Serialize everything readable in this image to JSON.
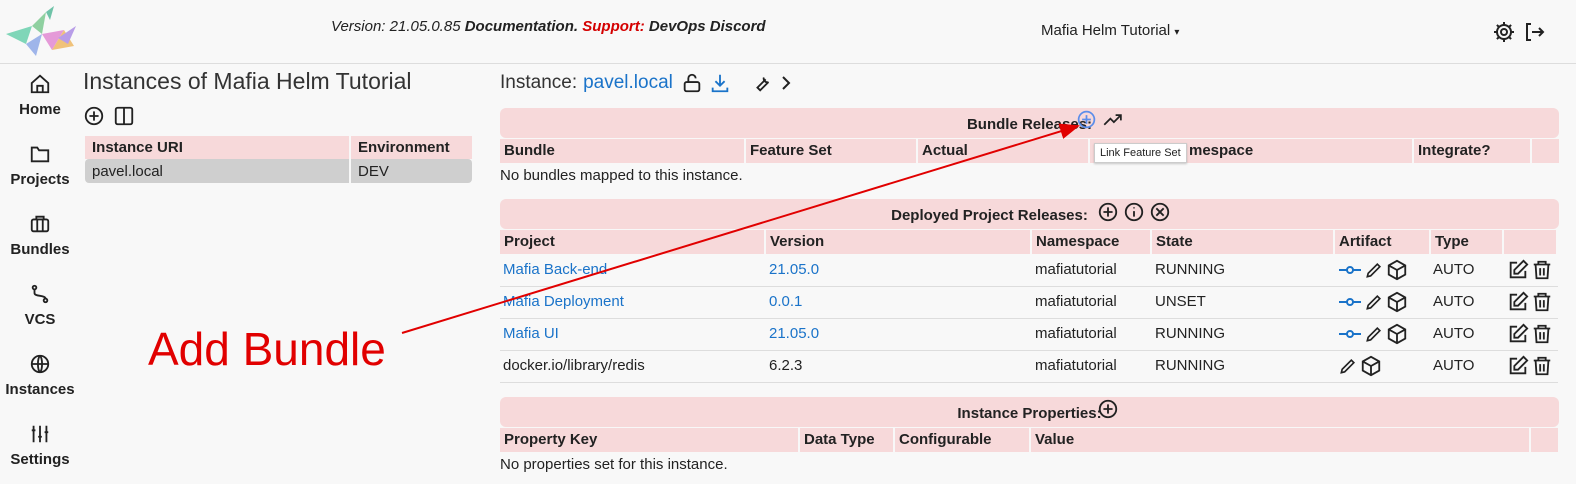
{
  "header": {
    "version_label": "Version: 21.05.0.85",
    "documentation_label": "Documentation.",
    "support_label": "Support:",
    "discord_label": "DevOps Discord",
    "project_select": "Mafia Helm Tutorial",
    "colors": {
      "support": "#d40000",
      "link": "#1a73c9",
      "section_bg": "#f7d9da"
    }
  },
  "sidebar": {
    "items": [
      {
        "label": "Home",
        "icon": "home-icon"
      },
      {
        "label": "Projects",
        "icon": "folder-icon"
      },
      {
        "label": "Bundles",
        "icon": "briefcase-icon"
      },
      {
        "label": "VCS",
        "icon": "git-branch-icon"
      },
      {
        "label": "Instances",
        "icon": "globe-icon"
      },
      {
        "label": "Settings",
        "icon": "sliders-icon"
      }
    ]
  },
  "left_panel": {
    "title": "Instances of Mafia Helm Tutorial",
    "columns": [
      "Instance URI",
      "Environment"
    ],
    "rows": [
      {
        "uri": "pavel.local",
        "environment": "DEV"
      }
    ]
  },
  "instance": {
    "label": "Instance:",
    "uri": "pavel.local"
  },
  "bundle_releases": {
    "title": "Bundle Releases:",
    "columns": [
      "Bundle",
      "Feature Set",
      "Actual",
      "Namespace",
      "Integrate?"
    ],
    "namespace_visible": "mespace",
    "empty_message": "No bundles mapped to this instance.",
    "tooltip": "Link Feature Set"
  },
  "deployed_releases": {
    "title": "Deployed Project Releases:",
    "columns": [
      "Project",
      "Version",
      "Namespace",
      "State",
      "Artifact",
      "Type"
    ],
    "rows": [
      {
        "project": "Mafia Back-end",
        "version": "21.05.0",
        "namespace": "mafiatutorial",
        "state": "RUNNING",
        "type": "AUTO",
        "linked": true
      },
      {
        "project": "Mafia Deployment",
        "version": "0.0.1",
        "namespace": "mafiatutorial",
        "state": "UNSET",
        "type": "AUTO",
        "linked": true
      },
      {
        "project": "Mafia UI",
        "version": "21.05.0",
        "namespace": "mafiatutorial",
        "state": "RUNNING",
        "type": "AUTO",
        "linked": true
      },
      {
        "project": "docker.io/library/redis",
        "version": "6.2.3",
        "namespace": "mafiatutorial",
        "state": "RUNNING",
        "type": "AUTO",
        "linked": false
      }
    ]
  },
  "instance_properties": {
    "title": "Instance Properties:",
    "columns": [
      "Property Key",
      "Data Type",
      "Configurable",
      "Value"
    ],
    "empty_message": "No properties set for this instance."
  },
  "annotation": {
    "text": "Add Bundle",
    "color": "#e10000"
  }
}
